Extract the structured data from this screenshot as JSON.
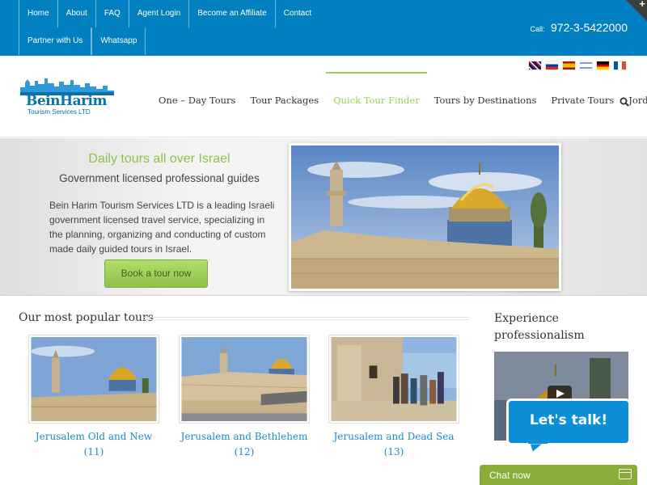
{
  "topbar": {
    "links": [
      "Home",
      "About",
      "FAQ",
      "Agent Login",
      "Become an Affiliate",
      "Contact",
      "Partner with Us",
      "Whatsapp"
    ],
    "call_label": "Call:",
    "phone": "972-3-5422000",
    "corner_glyph": "+"
  },
  "header": {
    "logo_name": "BeinHarim",
    "logo_sub": "Tourism Services LTD",
    "flags": [
      "uk-flag-icon",
      "russia-flag-icon",
      "spain-flag-icon",
      "israel-flag-icon",
      "germany-flag-icon",
      "france-flag-icon"
    ],
    "nav": [
      "One – Day Tours",
      "Tour Packages",
      "Quick Tour Finder",
      "Tours by Destinations",
      "Private Tours",
      "Jordan Tours"
    ],
    "active_nav": "Quick Tour Finder"
  },
  "hero": {
    "title": "Daily tours all over Israel",
    "subtitle": "Government licensed professional guides",
    "text": "Bein Harim Tourism Services LTD is a leading Israeli government licensed travel service, specializing in the planning, organizing and conducting of custom made daily guided tours in Israel.",
    "button": "Book a tour now"
  },
  "main": {
    "section_title": "Our most popular tours",
    "tours": [
      {
        "name": "Jerusalem Old and New (11)"
      },
      {
        "name": "Jerusalem and Bethlehem (12)"
      },
      {
        "name": "Jerusalem and Dead Sea (13)"
      }
    ]
  },
  "sidebar": {
    "title": "Experience professionalism"
  },
  "chat": {
    "bubble": "Let's talk!",
    "bar_label": "Chat now"
  },
  "colors": {
    "topbar": "#0080c0",
    "accent_green": "#a0ce4e",
    "link_blue": "#1d8ccb",
    "chat_green": "#8aad3a"
  }
}
